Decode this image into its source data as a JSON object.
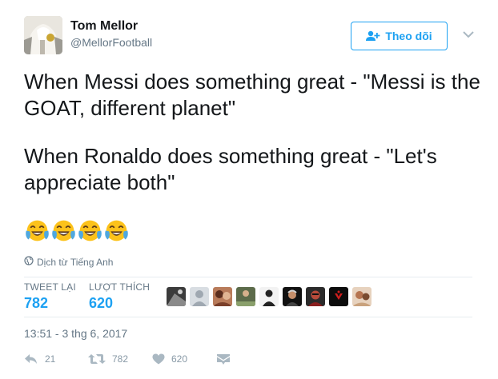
{
  "author": {
    "name": "Tom Mellor",
    "handle": "@MellorFootball"
  },
  "follow_button": {
    "label": "Theo dõi",
    "icon": "add-user-icon"
  },
  "tweet": {
    "paragraph_1": "When Messi does something great - \"Messi is the GOAT, different planet\"",
    "paragraph_2": "When Ronaldo does something great - \"Let's appreciate both\"",
    "emoji_count": 4,
    "emoji": "face-with-tears-of-joy"
  },
  "translate_link": "Dịch từ Tiếng Anh",
  "stats": {
    "retweets_label": "TWEET LẠI",
    "retweets_value": "782",
    "likes_label": "LƯỢT THÍCH",
    "likes_value": "620"
  },
  "likers_count": 9,
  "timestamp": "13:51 - 3 thg 6, 2017",
  "actions": {
    "reply_count": "21",
    "retweet_count": "782",
    "like_count": "620"
  },
  "colors": {
    "accent": "#1da1f2",
    "text": "#14171a",
    "muted": "#657786",
    "action_gray": "#8899a6"
  }
}
